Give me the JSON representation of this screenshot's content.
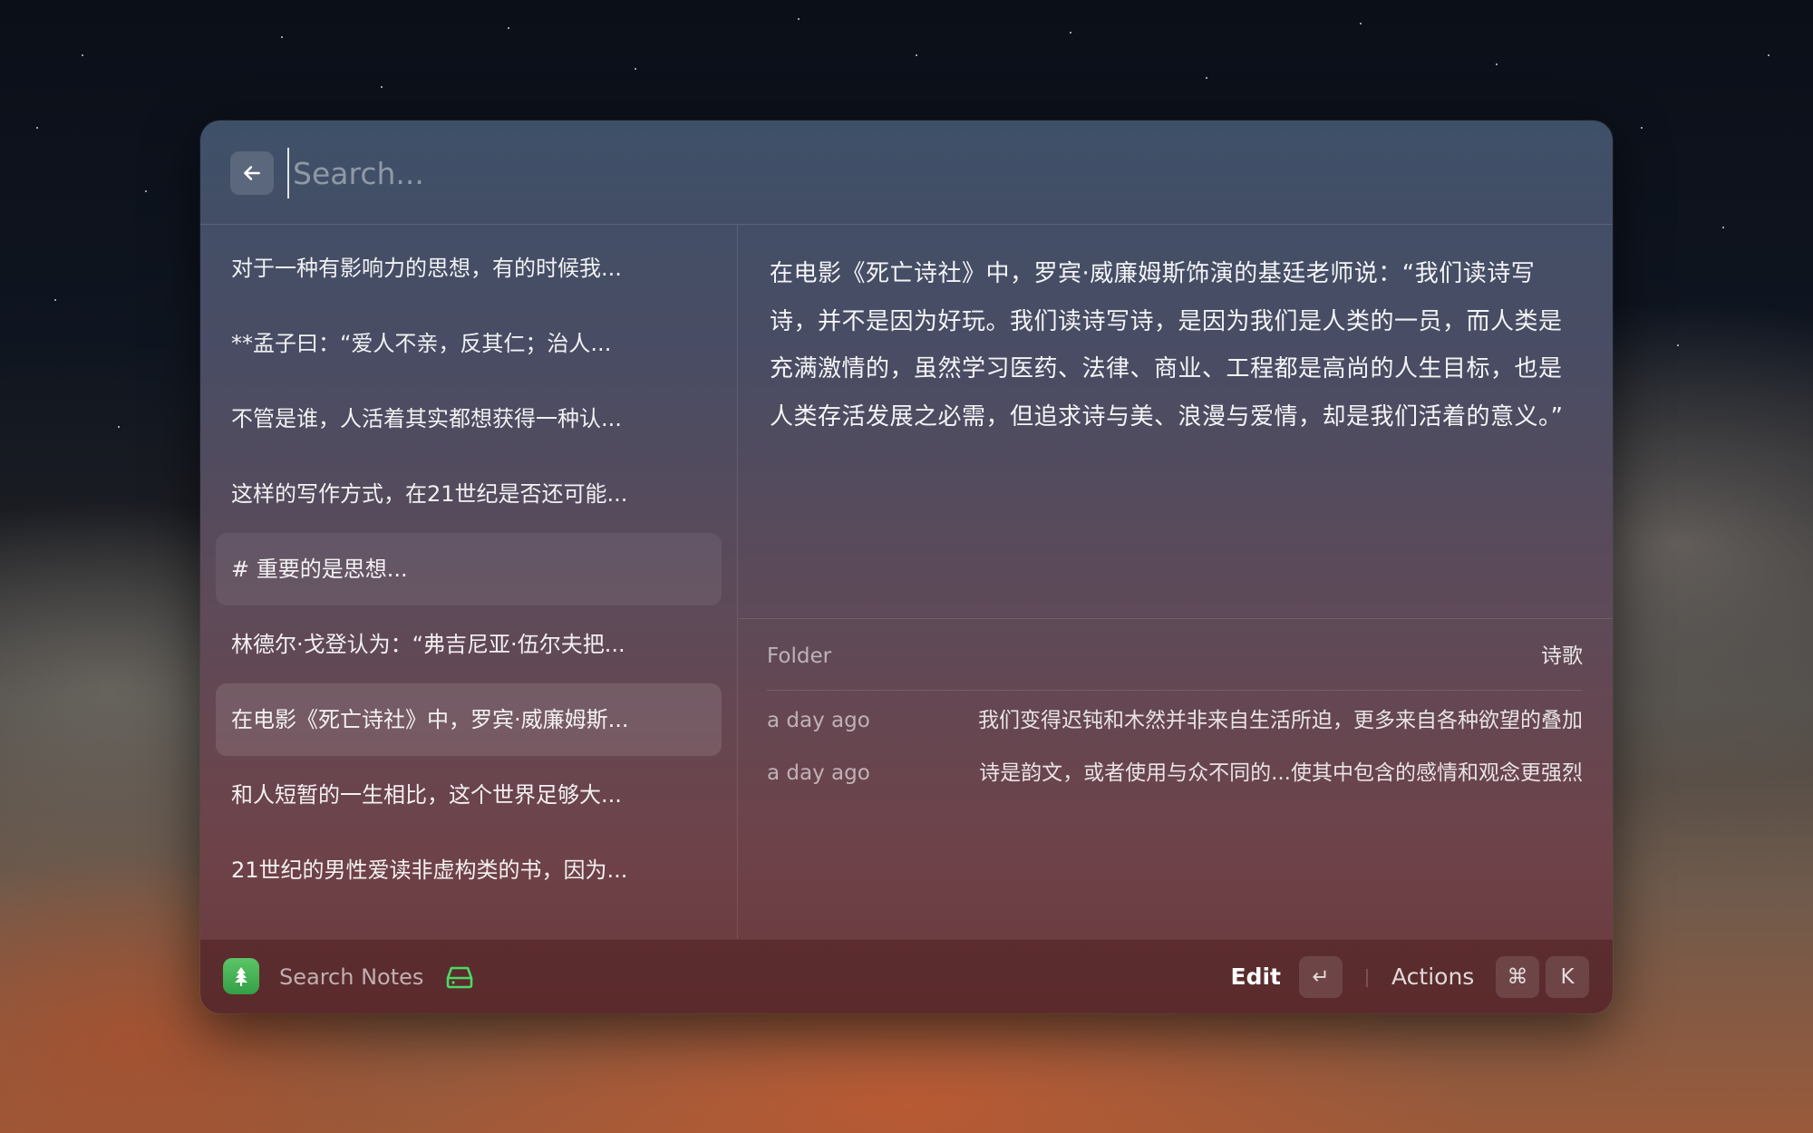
{
  "search": {
    "placeholder": "Search...",
    "value": ""
  },
  "notes": [
    {
      "label": "对于一种有影响力的思想，有的时候我..."
    },
    {
      "label": "**孟子曰：“爱人不亲，反其仁；治人..."
    },
    {
      "label": "不管是谁，人活着其实都想获得一种认..."
    },
    {
      "label": "这样的写作方式，在21世纪是否还可能..."
    },
    {
      "label": "# 重要的是思想..."
    },
    {
      "label": "林德尔·戈登认为：“弗吉尼亚·伍尔夫把..."
    },
    {
      "label": "在电影《死亡诗社》中，罗宾·威廉姆斯..."
    },
    {
      "label": "和人短暂的一生相比，这个世界足够大..."
    },
    {
      "label": "21世纪的男性爱读非虚构类的书，因为..."
    }
  ],
  "detail": {
    "content": "在电影《死亡诗社》中，罗宾·威廉姆斯饰演的基廷老师说：“我们读诗写诗，并不是因为好玩。我们读诗写诗，是因为我们是人类的一员，而人类是充满激情的，虽然学习医药、法律、商业、工程都是高尚的人生目标，也是人类存活发展之必需，但追求诗与美、浪漫与爱情，却是我们活着的意义。”",
    "metadata": {
      "folder_label": "Folder",
      "folder_value": "诗歌",
      "rows": [
        {
          "time": "a day ago",
          "text": "我们变得迟钝和木然并非来自生活所迫，更多来自各种欲望的叠加"
        },
        {
          "time": "a day ago",
          "text": "诗是韵文，或者使用与众不同的...使其中包含的感情和观念更强烈"
        }
      ]
    }
  },
  "footer": {
    "title": "Search Notes",
    "edit_label": "Edit",
    "edit_key": "↵",
    "actions_label": "Actions",
    "actions_keys": [
      "⌘",
      "K"
    ]
  },
  "icons": {
    "back": "arrow-left-icon",
    "app": "tree-icon",
    "storage": "hard-drive-icon"
  },
  "colors": {
    "accent_green": "#4cd964",
    "app_icon": "#46b050"
  }
}
